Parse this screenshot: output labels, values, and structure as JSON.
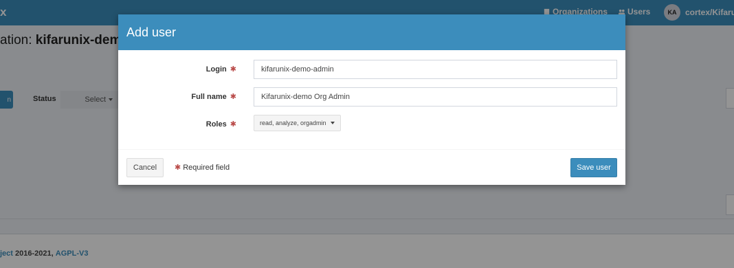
{
  "app": {
    "brand": "x",
    "nav": {
      "organizations": "Organizations",
      "users": "Users",
      "account_initials": "KA",
      "account_label": "cortex/Kifarun"
    }
  },
  "page": {
    "title_prefix": "ation: ",
    "title_org": "kifarunix-demo",
    "filter": {
      "button_label": "n",
      "status_label": "Status",
      "status_select": "Select"
    }
  },
  "footer": {
    "link_text": "ject",
    "years": "2016-2021,",
    "license": "AGPL-V3"
  },
  "modal": {
    "title": "Add user",
    "fields": {
      "login": {
        "label": "Login",
        "value": "kifarunix-demo-admin"
      },
      "full_name": {
        "label": "Full name",
        "value": "Kifarunix-demo Org Admin"
      },
      "roles": {
        "label": "Roles",
        "value": "read, analyze, orgadmin"
      }
    },
    "required_marker": "✱",
    "required_note": "Required field",
    "buttons": {
      "cancel": "Cancel",
      "save": "Save user"
    }
  },
  "colors": {
    "primary": "#3c8dbc",
    "required": "#b94a48"
  }
}
